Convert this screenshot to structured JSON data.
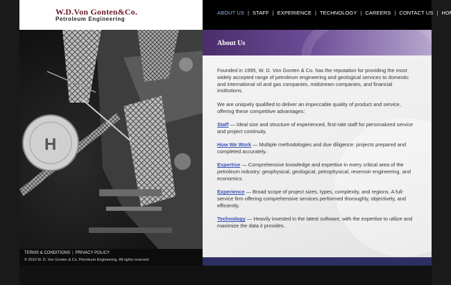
{
  "logo": {
    "title": "W.D.Von Gonten&Co.",
    "subtitle": "Petroleum Engineering"
  },
  "nav": {
    "items": [
      {
        "label": "ABOUT US",
        "active": true
      },
      {
        "label": "STAFF"
      },
      {
        "label": "EXPERIENCE"
      },
      {
        "label": "TECHNOLOGY"
      },
      {
        "label": "CAREERS"
      },
      {
        "label": "CONTACT US"
      },
      {
        "label": "HOME"
      }
    ],
    "separator": "|"
  },
  "header": {
    "title": "About Us"
  },
  "content": {
    "intro": "Founded in 1995, W. D. Von Gonten & Co. has the reputation for providing the most widely accepted range of petroleum engineering and geological services to domestic and international oil and gas companies, midstream companies, and financial institutions.",
    "qualified": "We are uniquely qualified to deliver an impeccable quality of product and service, offering these competitive advantages:",
    "advantages": [
      {
        "link": "Staff",
        "text": " — Ideal size and structure of experienced, first-rate staff for personalized service and project continuity."
      },
      {
        "link": "How We Work",
        "text": " — Multiple methodologies and due diligence: projects prepared and completed accurately."
      },
      {
        "link": "Expertise",
        "text": " — Comprehensive knowledge and expertise in every critical area of the petroleum industry: geophysical, geological, petrophysical, reservoir engineering, and economics."
      },
      {
        "link": "Experience",
        "text": " — Broad scope of project sizes, types, complexity, and regions. A full-service firm offering comprehensive services performed thoroughly, objectively, and efficiently."
      },
      {
        "link": "Technology",
        "text": " — Heavily invested in the latest software, with the expertise to utilize and maximize the data it provides."
      }
    ]
  },
  "footer": {
    "terms": "TERMS & CONDITIONS",
    "privacy": "PRIVACY POLICY",
    "separator": "|",
    "copyright": "© 2010 W. D. Von Gonten & Co. Petroleum Engineering. All rights reserved."
  },
  "photo": {
    "helipad_letter": "H"
  },
  "colors": {
    "nav_active": "#8fb2e8",
    "link": "#3b53b6",
    "logo_red": "#6b1b2c",
    "band_purple": "#6b4a95",
    "bottom_bar": "#2d2f62"
  }
}
